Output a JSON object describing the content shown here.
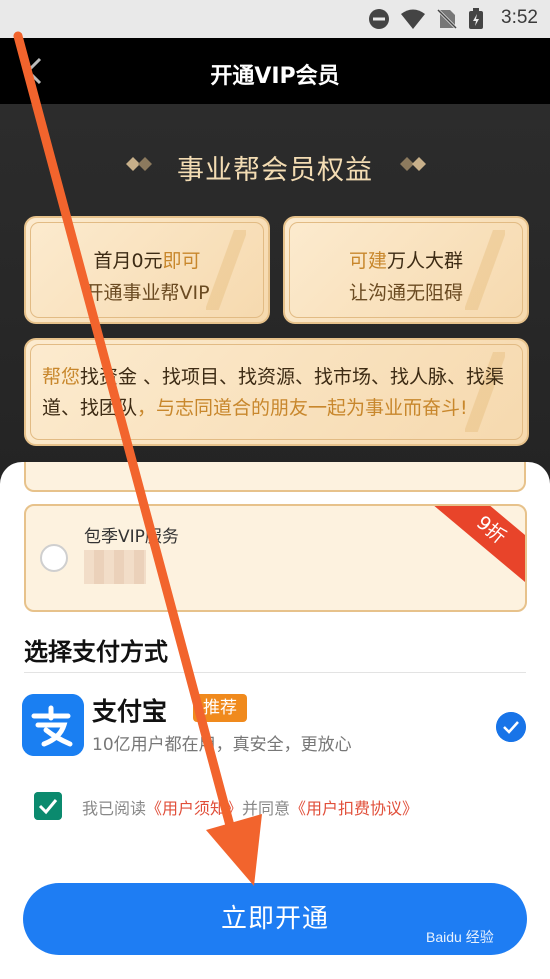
{
  "status_bar": {
    "time": "3:52"
  },
  "app_bar": {
    "title": "开通VIP会员"
  },
  "benefits": {
    "title": "事业帮会员权益",
    "card1": {
      "line1_a": "首月0元",
      "line1_b": "即可",
      "line2": "开通事业帮VIP"
    },
    "card2": {
      "line1_a": "可建",
      "line1_b": "万人大群",
      "line2": "让沟通无阻碍"
    },
    "card3": {
      "part1": "帮您",
      "part2": "找资金 、找项目、找资源、找市场、找人脉、找渠道、找团队",
      "part3": "，与志同道合的朋友一起为事业而奋斗!"
    }
  },
  "plan": {
    "name": "包季VIP服务",
    "discount": "9折"
  },
  "payment": {
    "section_title": "选择支付方式",
    "alipay_name": "支付宝",
    "recommend_badge": "推荐",
    "alipay_desc": "10亿用户都在用，真安全，更放心"
  },
  "agreement": {
    "prefix": "我已阅读",
    "link1": "《用户须知》",
    "middle": "并同意",
    "link2": "《用户扣费协议》"
  },
  "open_button": "立即开通",
  "watermark": "Baidu 经验",
  "colors": {
    "primary_blue": "#1e7df3",
    "gold": "#c8872c",
    "alipay_blue": "#1a7ff2",
    "discount_red": "#e8442a",
    "annotation_arrow": "#f2642d"
  }
}
